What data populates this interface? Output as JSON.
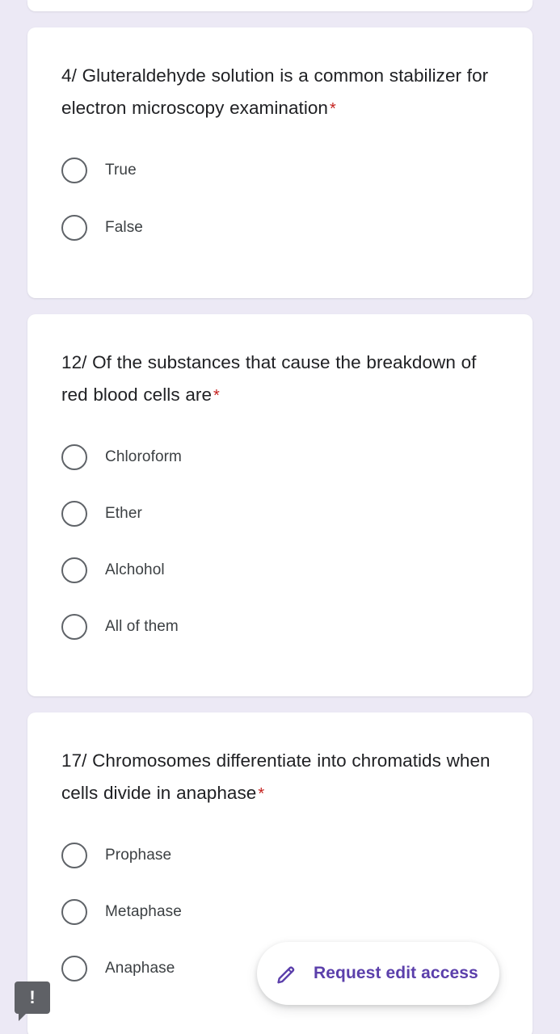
{
  "background_color": "#ECE9F5",
  "card_color": "#FFFFFF",
  "accent_color": "#5B3FAB",
  "required_star_color": "#C5221F",
  "radio_border_color": "#5F6368",
  "required_marker": "*",
  "questions": [
    {
      "title": "4/ Gluteraldehyde solution is a common stabilizer for electron microscopy examination",
      "options": [
        {
          "label": "True"
        },
        {
          "label": "False"
        }
      ]
    },
    {
      "title": "12/ Of the substances that cause the breakdown of red blood cells are",
      "options": [
        {
          "label": "Chloroform"
        },
        {
          "label": "Ether"
        },
        {
          "label": "Alchohol"
        },
        {
          "label": "All of them"
        }
      ]
    },
    {
      "title": "17/ Chromosomes differentiate into chromatids when cells divide in anaphase",
      "options": [
        {
          "label": "Prophase"
        },
        {
          "label": "Metaphase"
        },
        {
          "label": "Anaphase"
        }
      ]
    }
  ],
  "request_access": {
    "label": "Request edit access",
    "icon": "pencil-icon"
  },
  "feedback": {
    "icon": "feedback-bubble-icon",
    "glyph": "!"
  }
}
